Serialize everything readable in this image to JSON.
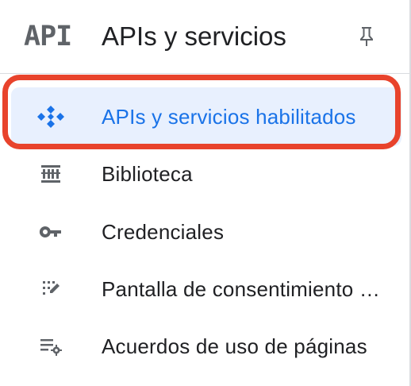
{
  "header": {
    "logo_text": "API",
    "title": "APIs y servicios",
    "pin_icon": "pin-icon"
  },
  "nav": {
    "items": [
      {
        "label": "APIs y servicios habilitados",
        "icon": "enabled-apis-icon",
        "active": true
      },
      {
        "label": "Biblioteca",
        "icon": "library-icon",
        "active": false
      },
      {
        "label": "Credenciales",
        "icon": "key-icon",
        "active": false
      },
      {
        "label": "Pantalla de consentimiento de OAuth",
        "icon": "consent-screen-icon",
        "active": false
      },
      {
        "label": "Acuerdos de uso de páginas",
        "icon": "page-usage-agreements-icon",
        "active": false
      }
    ]
  },
  "colors": {
    "active_text": "#1a73e8",
    "active_bg": "#e8f0fe",
    "highlight_border": "#e8432c",
    "icon_gray": "#5f6368",
    "text": "#202124"
  }
}
